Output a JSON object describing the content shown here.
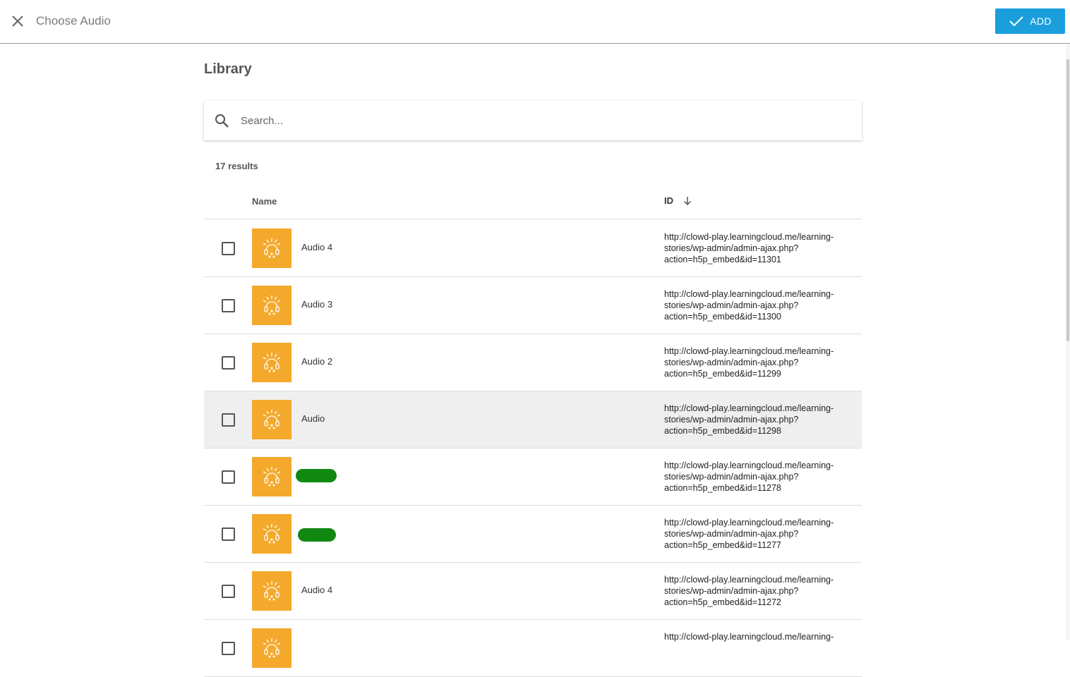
{
  "header": {
    "title": "Choose Audio",
    "add_label": "ADD"
  },
  "library": {
    "title": "Library",
    "search_placeholder": "Search...",
    "results_count": "17 results",
    "columns": {
      "name": "Name",
      "id": "ID"
    },
    "rows": [
      {
        "name": "Audio 4",
        "id": "http://clowd-play.learningcloud.me/learning-stories/wp-admin/admin-ajax.php?action=h5p_embed&id=11301"
      },
      {
        "name": "Audio 3",
        "id": "http://clowd-play.learningcloud.me/learning-stories/wp-admin/admin-ajax.php?action=h5p_embed&id=11300"
      },
      {
        "name": "Audio 2",
        "id": "http://clowd-play.learningcloud.me/learning-stories/wp-admin/admin-ajax.php?action=h5p_embed&id=11299"
      },
      {
        "name": "Audio",
        "id": "http://clowd-play.learningcloud.me/learning-stories/wp-admin/admin-ajax.php?action=h5p_embed&id=11298"
      },
      {
        "name": "",
        "id": "http://clowd-play.learningcloud.me/learning-stories/wp-admin/admin-ajax.php?action=h5p_embed&id=11278"
      },
      {
        "name": "",
        "id": "http://clowd-play.learningcloud.me/learning-stories/wp-admin/admin-ajax.php?action=h5p_embed&id=11277"
      },
      {
        "name": "Audio 4",
        "id": "http://clowd-play.learningcloud.me/learning-stories/wp-admin/admin-ajax.php?action=h5p_embed&id=11272"
      },
      {
        "name": "",
        "id": "http://clowd-play.learningcloud.me/learning-"
      }
    ]
  },
  "colors": {
    "accent": "#1a9fdc",
    "thumbnail": "#f4a92c",
    "redaction": "#118811"
  },
  "icons": {
    "close": "close-icon",
    "check": "check-icon",
    "search": "search-icon",
    "sort": "arrow-down-icon",
    "thumbnail": "headphones-icon"
  }
}
